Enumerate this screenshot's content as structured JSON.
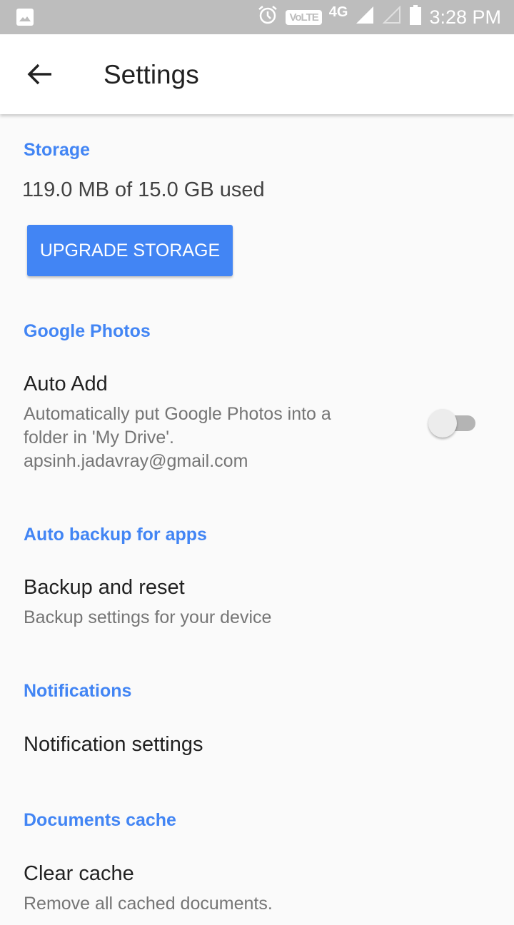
{
  "status_bar": {
    "left_icons": [
      "image-icon"
    ],
    "right_icons": [
      "alarm-icon",
      "volte-icon",
      "4g-icon",
      "signal-icon",
      "signal-empty-icon",
      "battery-icon"
    ],
    "volte_label": "VoLTE",
    "network_label": "4G",
    "time": "3:28 PM"
  },
  "app_bar": {
    "back_icon": "arrow-back-icon",
    "title": "Settings"
  },
  "sections": {
    "storage": {
      "header": "Storage",
      "usage": "119.0 MB of 15.0 GB used",
      "upgrade_button": "UPGRADE STORAGE"
    },
    "google_photos": {
      "header": "Google Photos",
      "auto_add": {
        "title": "Auto Add",
        "summary_line1": "Automatically put Google Photos into a",
        "summary_line2": "folder in 'My Drive'.",
        "account": "apsinh.jadavray@gmail.com",
        "toggle_on": false
      }
    },
    "auto_backup": {
      "header": "Auto backup for apps",
      "item_title": "Backup and reset",
      "item_summary": "Backup settings for your device"
    },
    "notifications": {
      "header": "Notifications",
      "item_title": "Notification settings"
    },
    "documents_cache": {
      "header": "Documents cache",
      "item_title": "Clear cache",
      "item_summary": "Remove all cached documents."
    }
  },
  "colors": {
    "accent": "#4285f4",
    "status_bar": "#bdbdbd"
  }
}
